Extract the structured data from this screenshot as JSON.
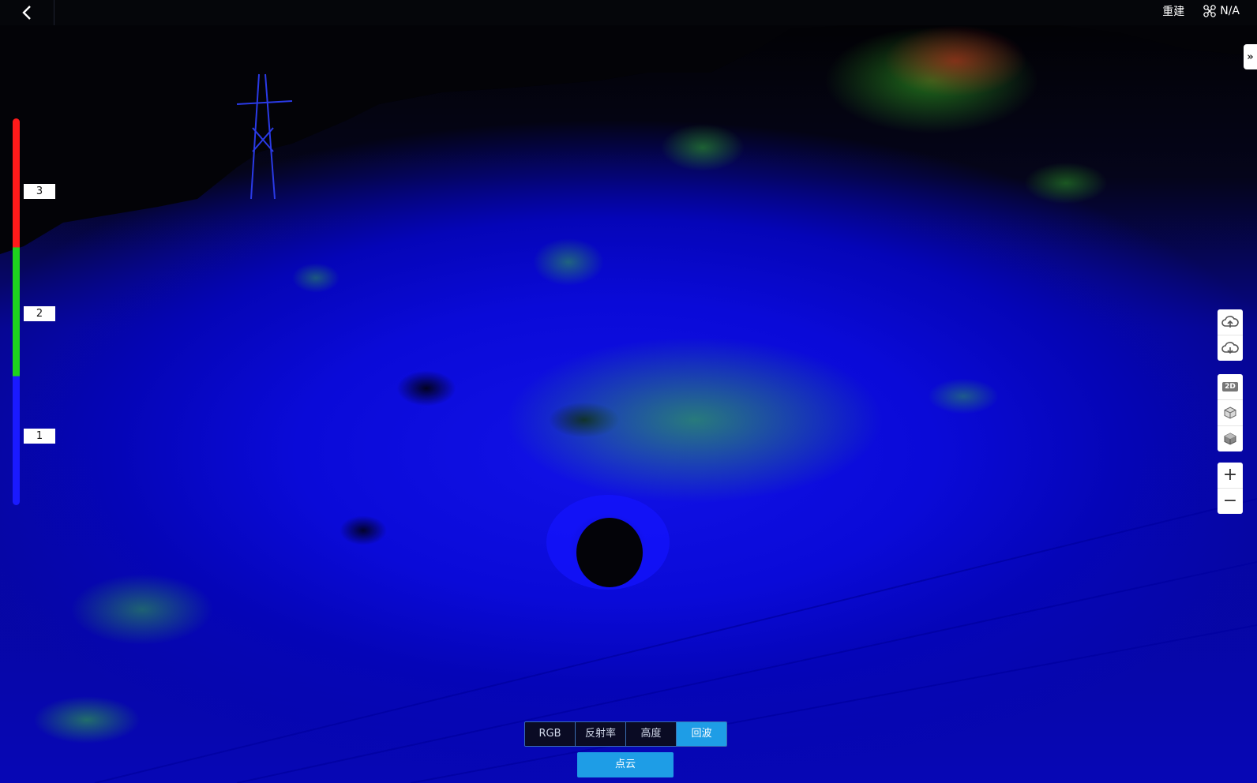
{
  "topbar": {
    "rebuild_label": "重建",
    "drone_status": "N/A",
    "icons": {
      "back": "chevron-left-icon",
      "drone": "drone-icon"
    }
  },
  "legend": {
    "ticks": [
      "3",
      "2",
      "1"
    ],
    "colors": {
      "high": "#ff1a1a",
      "mid": "#1ed31e",
      "low": "#1a1aff"
    }
  },
  "right_tools": {
    "group1": [
      "cloud-upload-icon",
      "cloud-download-icon"
    ],
    "group2": {
      "view_2d_label": "2D",
      "icons": [
        "2d-view-icon",
        "cube-view-icon",
        "cube-solid-view-icon"
      ]
    },
    "zoom": {
      "in_label": "+",
      "out_label": "−"
    }
  },
  "bottom": {
    "tabs": [
      "RGB",
      "反射率",
      "高度",
      "回波"
    ],
    "active_tab": "回波",
    "pointcloud_label": "点云"
  },
  "colors": {
    "accent": "#1e9de6",
    "topbar_bg": "#05060a"
  }
}
